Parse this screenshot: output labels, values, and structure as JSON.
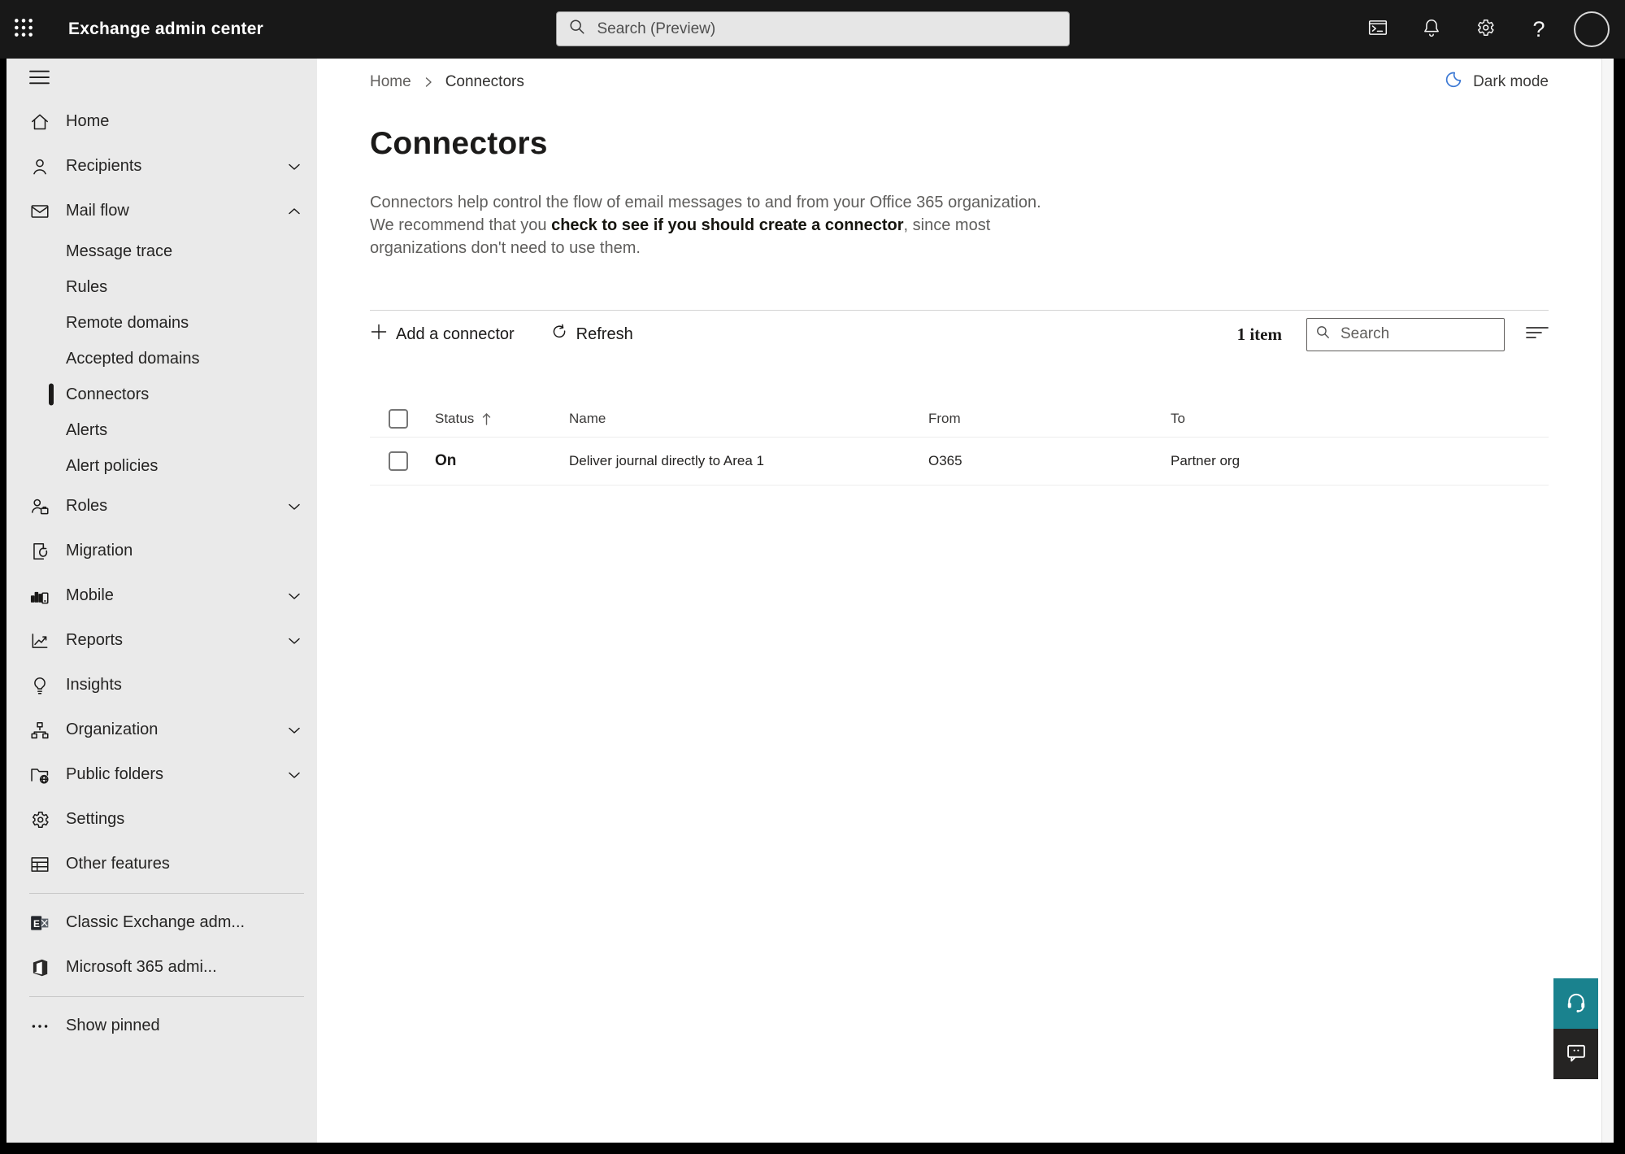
{
  "topbar": {
    "app_title": "Exchange admin center",
    "search_placeholder": "Search (Preview)"
  },
  "sidebar": {
    "items": [
      {
        "label": "Home"
      },
      {
        "label": "Recipients",
        "chevron": "down"
      },
      {
        "label": "Mail flow",
        "chevron": "up",
        "expanded": true
      },
      {
        "label": "Message trace",
        "type": "sub"
      },
      {
        "label": "Rules",
        "type": "sub"
      },
      {
        "label": "Remote domains",
        "type": "sub"
      },
      {
        "label": "Accepted domains",
        "type": "sub"
      },
      {
        "label": "Connectors",
        "type": "sub",
        "selected": true
      },
      {
        "label": "Alerts",
        "type": "sub"
      },
      {
        "label": "Alert policies",
        "type": "sub"
      },
      {
        "label": "Roles",
        "chevron": "down"
      },
      {
        "label": "Migration"
      },
      {
        "label": "Mobile",
        "chevron": "down"
      },
      {
        "label": "Reports",
        "chevron": "down"
      },
      {
        "label": "Insights"
      },
      {
        "label": "Organization",
        "chevron": "down"
      },
      {
        "label": "Public folders",
        "chevron": "down"
      },
      {
        "label": "Settings"
      },
      {
        "label": "Other features"
      },
      {
        "label": "Classic Exchange adm..."
      },
      {
        "label": "Microsoft 365 admi..."
      },
      {
        "label": "Show pinned"
      }
    ]
  },
  "page": {
    "breadcrumb": [
      "Home",
      "Connectors"
    ],
    "dark_mode_label": "Dark mode",
    "title": "Connectors",
    "description": {
      "pre": "Connectors help control the flow of email messages to and from your Office 365 organization. We recommend that you ",
      "link": "check to see if you should create a connector",
      "post": ", since most organizations don't need to use them."
    }
  },
  "toolbar": {
    "add_label": "Add a connector",
    "refresh_label": "Refresh",
    "item_count": "1 item",
    "search_placeholder": "Search"
  },
  "table": {
    "columns": [
      "Status",
      "Name",
      "From",
      "To"
    ],
    "rows": [
      {
        "status": "On",
        "name": "Deliver journal directly to Area 1",
        "from": "O365",
        "to": "Partner org"
      }
    ]
  },
  "colors": {
    "accent_teal": "#1a828e",
    "moon_blue": "#3b78d4",
    "topbar_bg": "#181818",
    "sidebar_bg": "#eaeaea"
  }
}
